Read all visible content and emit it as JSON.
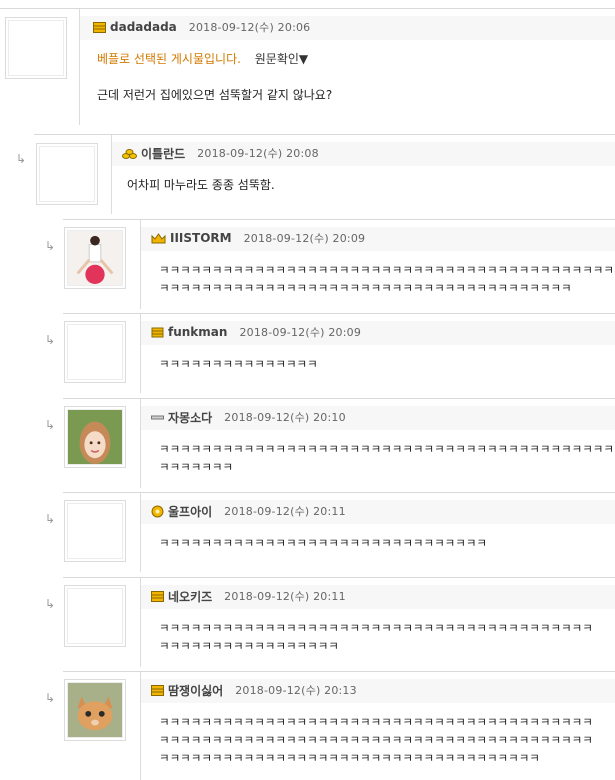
{
  "comments": [
    {
      "nick": "dadadada",
      "date": "2018-09-12(수) 20:06",
      "level_icon": "gold-bar-level-icon",
      "best_label": "베플로 선택된 게시물입니다.",
      "original_link": "원문확인▼",
      "text": "근데 저런거 집에있으면 섬뚝할거 같지 않나요?"
    },
    {
      "nick": "이틀란드",
      "date": "2018-09-12(수) 20:08",
      "level_icon": "gold-coins-level-icon",
      "text": "어차피 마누라도 종종 섬뚝함."
    },
    {
      "nick": "IIISTORM",
      "date": "2018-09-12(수) 20:09",
      "level_icon": "gold-crown-level-icon",
      "lines": [
        "ㅋㅋㅋㅋㅋㅋㅋㅋㅋㅋㅋㅋㅋㅋㅋㅋㅋㅋㅋㅋㅋㅋㅋㅋㅋㅋㅋㅋㅋㅋㅋㅋㅋㅋㅋㅋㅋㅋㅋㅋㅋㅋㅋ",
        "ㅋㅋㅋㅋㅋㅋㅋㅋㅋㅋㅋㅋㅋㅋㅋㅋㅋㅋㅋㅋㅋㅋㅋㅋㅋㅋㅋㅋㅋㅋㅋㅋㅋㅋㅋㅋㅋㅋㅋ"
      ]
    },
    {
      "nick": "funkman",
      "date": "2018-09-12(수) 20:09",
      "level_icon": "gold-stack-level-icon",
      "lines": [
        "ㅋㅋㅋㅋㅋㅋㅋㅋㅋㅋㅋㅋㅋㅋㅋ"
      ]
    },
    {
      "nick": "자몽소다",
      "date": "2018-09-12(수) 20:10",
      "level_icon": "silver-bar-level-icon",
      "lines": [
        "ㅋㅋㅋㅋㅋㅋㅋㅋㅋㅋㅋㅋㅋㅋㅋㅋㅋㅋㅋㅋㅋㅋㅋㅋㅋㅋㅋㅋㅋㅋㅋㅋㅋㅋㅋㅋㅋㅋㅋㅋㅋㅋㅋ",
        "ㅋㅋㅋㅋㅋㅋㅋ"
      ]
    },
    {
      "nick": "울프아이",
      "date": "2018-09-12(수) 20:11",
      "level_icon": "gold-flower-level-icon",
      "lines": [
        "ㅋㅋㅋㅋㅋㅋㅋㅋㅋㅋㅋㅋㅋㅋㅋㅋㅋㅋㅋㅋㅋㅋㅋㅋㅋㅋㅋㅋㅋㅋㅋ"
      ]
    },
    {
      "nick": "네오키즈",
      "date": "2018-09-12(수) 20:11",
      "level_icon": "gold-bar-level-icon",
      "lines": [
        "ㅋㅋㅋㅋㅋㅋㅋㅋㅋㅋㅋㅋㅋㅋㅋㅋㅋㅋㅋㅋㅋㅋㅋㅋㅋㅋㅋㅋㅋㅋㅋㅋㅋㅋㅋㅋㅋㅋㅋㅋㅋ",
        "ㅋㅋㅋㅋㅋㅋㅋㅋㅋㅋㅋㅋㅋㅋㅋㅋㅋ"
      ]
    },
    {
      "nick": "땀쟁이싫어",
      "date": "2018-09-12(수) 20:13",
      "level_icon": "gold-bar-level-icon",
      "lines": [
        "ㅋㅋㅋㅋㅋㅋㅋㅋㅋㅋㅋㅋㅋㅋㅋㅋㅋㅋㅋㅋㅋㅋㅋㅋㅋㅋㅋㅋㅋㅋㅋㅋㅋㅋㅋㅋㅋㅋㅋㅋㅋ",
        "ㅋㅋㅋㅋㅋㅋㅋㅋㅋㅋㅋㅋㅋㅋㅋㅋㅋㅋㅋㅋㅋㅋㅋㅋㅋㅋㅋㅋㅋㅋㅋㅋㅋㅋㅋㅋㅋㅋㅋㅋㅋ",
        "ㅋㅋㅋㅋㅋㅋㅋㅋㅋㅋㅋㅋㅋㅋㅋㅋㅋㅋㅋㅋㅋㅋㅋㅋㅋㅋㅋㅋㅋㅋㅋㅋㅋㅋㅋㅋ"
      ]
    }
  ],
  "reply_arrow": "↳"
}
